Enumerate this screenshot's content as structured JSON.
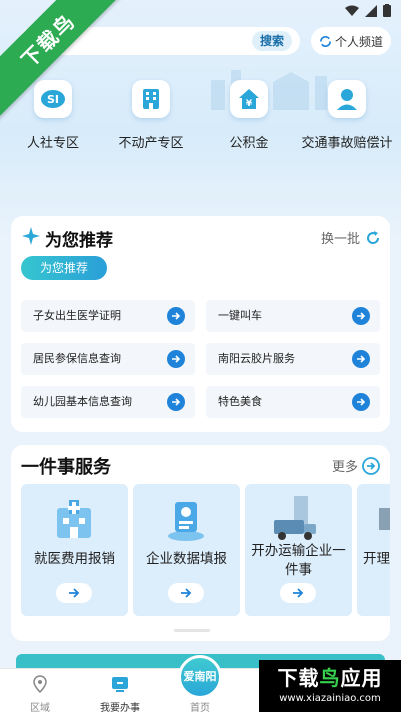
{
  "ribbon": {
    "text": "下载鸟"
  },
  "search": {
    "button_label": "搜索"
  },
  "personal_channel": {
    "label": "个人频道"
  },
  "quick_entries": [
    {
      "label": "人社专区",
      "icon": "social-security-icon"
    },
    {
      "label": "不动产专区",
      "icon": "building-icon"
    },
    {
      "label": "公积金",
      "icon": "housing-fund-icon"
    },
    {
      "label": "交通事故赔偿计",
      "icon": "traffic-person-icon"
    }
  ],
  "recommend": {
    "title": "为您推荐",
    "refresh_label": "换一批",
    "active_tab": "为您推荐",
    "items": [
      "子女出生医学证明",
      "一键叫车",
      "居民参保信息查询",
      "南阳云胶片服务",
      "幼儿园基本信息查询",
      "特色美食"
    ]
  },
  "events": {
    "title": "一件事服务",
    "more_label": "更多",
    "items": [
      {
        "name": "就医费用报销",
        "icon": "hospital-icon"
      },
      {
        "name": "企业数据填报",
        "icon": "data-report-icon"
      },
      {
        "name": "开办运输企业一件事",
        "icon": "truck-icon"
      },
      {
        "name": "开理",
        "icon": "partial-icon"
      }
    ]
  },
  "bottom_nav": {
    "region": "区域",
    "todo": "我要办事",
    "home_badge": "爱南阳",
    "home": "首页"
  },
  "watermark": {
    "main_black": "下载",
    "main_green": "鸟",
    "main_rest": "应用",
    "url": "www.xiazainiao.com"
  },
  "colors": {
    "accent": "#1f84d9",
    "teal": "#39bfc8",
    "ribbon": "#2dab52"
  }
}
